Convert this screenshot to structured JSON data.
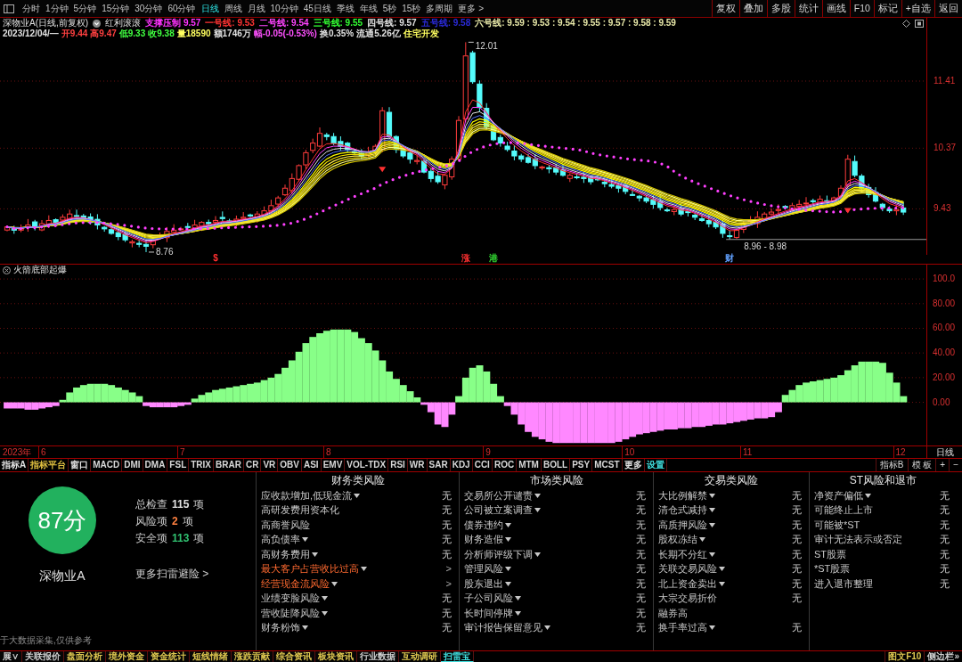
{
  "toolbar": {
    "periods": [
      {
        "label": "分时",
        "selected": false
      },
      {
        "label": "1分钟",
        "selected": false
      },
      {
        "label": "5分钟",
        "selected": false
      },
      {
        "label": "15分钟",
        "selected": false
      },
      {
        "label": "30分钟",
        "selected": false
      },
      {
        "label": "60分钟",
        "selected": false
      },
      {
        "label": "日线",
        "selected": true
      },
      {
        "label": "周线",
        "selected": false
      },
      {
        "label": "月线",
        "selected": false
      },
      {
        "label": "10分钟",
        "selected": false
      },
      {
        "label": "45日线",
        "selected": false
      },
      {
        "label": "季线",
        "selected": false
      },
      {
        "label": "年线",
        "selected": false
      },
      {
        "label": "5秒",
        "selected": false
      },
      {
        "label": "15秒",
        "selected": false
      },
      {
        "label": "多周期",
        "selected": false
      },
      {
        "label": "更多 >",
        "selected": false
      }
    ],
    "actions": [
      "复权",
      "叠加",
      "多股",
      "统计",
      "画线",
      "F10",
      "标记",
      "+自选",
      "返回"
    ]
  },
  "quote": {
    "title": "深物业A(日线,前复权)",
    "indicator": "红利滚滚",
    "values": [
      {
        "text": "支撑压制 9.57",
        "color": "#ff33ff"
      },
      {
        "text": "一号线: 9.53",
        "color": "#ff3333"
      },
      {
        "text": "二号线: 9.54",
        "color": "#ff44ff"
      },
      {
        "text": "三号线: 9.55",
        "color": "#33ff33"
      },
      {
        "text": "四号线: 9.57",
        "color": "#e0e0e0"
      },
      {
        "text": "五号线: 9.58",
        "color": "#2a2ad8"
      },
      {
        "text": "六号线: 9.59 : 9.53 : 9.54 : 9.55 : 9.57 : 9.58 : 9.59",
        "color": "#e8e8a8"
      }
    ],
    "daily": [
      {
        "text": "2023/12/04/—",
        "color": "#e0e0e0"
      },
      {
        "text": "开9.44",
        "color": "#ff4040"
      },
      {
        "text": "高9.47",
        "color": "#ff4040"
      },
      {
        "text": "低9.33",
        "color": "#40ff40"
      },
      {
        "text": "收9.38",
        "color": "#40ff40"
      },
      {
        "text": "量18590",
        "color": "#ffff60"
      },
      {
        "text": "额1746万",
        "color": "#e0e0e0"
      },
      {
        "text": "幅-0.05(-0.53%)",
        "color": "#ff50ff"
      },
      {
        "text": "换0.35%",
        "color": "#e0e0e0"
      },
      {
        "text": "流通5.26亿",
        "color": "#e0e0e0"
      },
      {
        "text": "住宅开发",
        "color": "#ffff60"
      }
    ]
  },
  "price_chart": {
    "axis_labels": [
      "11.41",
      "10.37",
      "9.43"
    ],
    "annotations": [
      "12.01",
      "8.76",
      "8.96 - 8.98"
    ],
    "events": [
      {
        "label": "$",
        "color": "#ff3030"
      },
      {
        "label": "涨",
        "color": "#ff3030"
      },
      {
        "label": "港",
        "color": "#30d030"
      },
      {
        "label": "财",
        "color": "#60a0ff"
      }
    ]
  },
  "indicator_panel": {
    "chart_data": {
      "type": "bar",
      "title": "火箭底部起爆",
      "xlabel": "2023年",
      "categories": [
        null,
        null,
        null,
        null,
        null,
        "6",
        null,
        null,
        null,
        null,
        null,
        null,
        null,
        null,
        null,
        null,
        null,
        null,
        null,
        null,
        null,
        null,
        null,
        null,
        null,
        "7",
        null,
        null,
        null,
        null,
        null,
        null,
        null,
        null,
        null,
        null,
        null,
        null,
        null,
        null,
        null,
        null,
        null,
        null,
        null,
        null,
        "8",
        null,
        null,
        null,
        null,
        null,
        null,
        null,
        null,
        null,
        null,
        null,
        null,
        null,
        null,
        null,
        null,
        null,
        null,
        null,
        null,
        null,
        null,
        "9",
        null,
        null,
        null,
        null,
        null,
        null,
        null,
        null,
        null,
        null,
        null,
        null,
        null,
        null,
        null,
        null,
        null,
        null,
        null,
        "10",
        null,
        null,
        null,
        null,
        null,
        null,
        null,
        null,
        null,
        null,
        null,
        null,
        null,
        null,
        null,
        null,
        "11",
        null,
        null,
        null,
        null,
        null,
        null,
        null,
        null,
        null,
        null,
        null,
        null,
        null,
        null,
        null,
        null,
        null,
        null,
        null,
        null,
        null,
        "12",
        null
      ],
      "ylim": [
        -35,
        112
      ],
      "yticks": [
        {
          "value": 100,
          "label": "100.0"
        },
        {
          "value": 80,
          "label": "80.00"
        },
        {
          "value": 60,
          "label": "60.00"
        },
        {
          "value": 40,
          "label": "40.00"
        },
        {
          "value": 20,
          "label": "20.00"
        },
        {
          "value": 0,
          "label": "0.00"
        }
      ],
      "grid": true,
      "values": [
        -5,
        -5,
        -5,
        -6,
        -6,
        -5,
        -4,
        -3,
        2,
        8,
        12,
        14,
        15,
        15,
        15,
        14,
        12,
        10,
        8,
        5,
        -3,
        -4,
        -4,
        -4,
        -4,
        -3,
        -2,
        3,
        6,
        8,
        10,
        11,
        12,
        13,
        14,
        15,
        16,
        18,
        20,
        23,
        28,
        34,
        41,
        48,
        53,
        56,
        58,
        59,
        59,
        59,
        57,
        52,
        48,
        42,
        34,
        25,
        19,
        14,
        9,
        4,
        -2,
        -8,
        -18,
        -20,
        -10,
        5,
        20,
        28,
        30,
        25,
        15,
        5,
        -3,
        -10,
        -18,
        -24,
        -28,
        -30,
        -32,
        -33,
        -33,
        -33,
        -33,
        -33,
        -33,
        -33,
        -33,
        -33,
        -32,
        -30,
        -28,
        -26,
        -25,
        -24,
        -23,
        -22,
        -22,
        -21,
        -21,
        -20,
        -20,
        -19,
        -18,
        -18,
        -17,
        -16,
        -15,
        -14,
        -13,
        -13,
        -12,
        -8,
        6,
        10,
        14,
        16,
        17,
        18,
        19,
        20,
        22,
        26,
        30,
        33,
        33,
        33,
        32,
        24,
        16,
        5
      ]
    }
  },
  "period_label": "日线",
  "indicator_bar": {
    "tabs": [
      {
        "label": "指标A",
        "color": "#e0e0e0"
      },
      {
        "label": "指标平台",
        "color": "#e0c040"
      },
      {
        "label": "窗口",
        "color": "#e0e0e0"
      },
      {
        "label": "MACD",
        "color": "#d8d8d8"
      },
      {
        "label": "DMI",
        "color": "#d8d8d8"
      },
      {
        "label": "DMA",
        "color": "#d8d8d8"
      },
      {
        "label": "FSL",
        "color": "#d8d8d8"
      },
      {
        "label": "TRIX",
        "color": "#d8d8d8"
      },
      {
        "label": "BRAR",
        "color": "#d8d8d8"
      },
      {
        "label": "CR",
        "color": "#d8d8d8"
      },
      {
        "label": "VR",
        "color": "#d8d8d8"
      },
      {
        "label": "OBV",
        "color": "#d8d8d8"
      },
      {
        "label": "ASI",
        "color": "#d8d8d8"
      },
      {
        "label": "EMV",
        "color": "#d8d8d8"
      },
      {
        "label": "VOL-TDX",
        "color": "#d8d8d8"
      },
      {
        "label": "RSI",
        "color": "#d8d8d8"
      },
      {
        "label": "WR",
        "color": "#d8d8d8"
      },
      {
        "label": "SAR",
        "color": "#d8d8d8"
      },
      {
        "label": "KDJ",
        "color": "#d8d8d8"
      },
      {
        "label": "CCI",
        "color": "#d8d8d8"
      },
      {
        "label": "ROC",
        "color": "#d8d8d8"
      },
      {
        "label": "MTM",
        "color": "#d8d8d8"
      },
      {
        "label": "BOLL",
        "color": "#d8d8d8"
      },
      {
        "label": "PSY",
        "color": "#d8d8d8"
      },
      {
        "label": "MCST",
        "color": "#d8d8d8"
      },
      {
        "label": "更多",
        "color": "#e0e0e0"
      },
      {
        "label": "设置",
        "color": "#40e0e0"
      }
    ],
    "right": [
      "指标B",
      "模 板",
      "+",
      "−"
    ]
  },
  "scan": {
    "score": "87分",
    "stock": "深物业A",
    "stats": [
      {
        "label": "总检查",
        "value": "115",
        "unit": "项",
        "color": "#e0e0e0"
      },
      {
        "label": "风险项",
        "value": "2",
        "unit": "项",
        "color": "#ff8040"
      },
      {
        "label": "安全项",
        "value": "113",
        "unit": "项",
        "color": "#30c070"
      }
    ],
    "more_link": "更多扫雷避险 >",
    "disclaimer": "于大数据采集,仅供参考",
    "categories": [
      {
        "title": "财务类风险",
        "items": [
          {
            "name": "应收款增加,低现金流",
            "expandable": true,
            "status": "无",
            "risk": false
          },
          {
            "name": "高研发费用资本化",
            "expandable": false,
            "status": "无",
            "risk": false
          },
          {
            "name": "高商誉风险",
            "expandable": false,
            "status": "无",
            "risk": false
          },
          {
            "name": "高负债率",
            "expandable": true,
            "status": "无",
            "risk": false
          },
          {
            "name": "高财务费用",
            "expandable": true,
            "status": "无",
            "risk": false
          },
          {
            "name": "最大客户占营收比过高",
            "expandable": true,
            "status": ">",
            "risk": true
          },
          {
            "name": "经营现金流风险",
            "expandable": true,
            "status": ">",
            "risk": true
          },
          {
            "name": "业绩变脸风险",
            "expandable": true,
            "status": "无",
            "risk": false
          },
          {
            "name": "营收陡降风险",
            "expandable": true,
            "status": "无",
            "risk": false
          },
          {
            "name": "财务粉饰",
            "expandable": true,
            "status": "无",
            "risk": false
          }
        ]
      },
      {
        "title": "市场类风险",
        "items": [
          {
            "name": "交易所公开谴责",
            "expandable": true,
            "status": "无",
            "risk": false
          },
          {
            "name": "公司被立案调查",
            "expandable": true,
            "status": "无",
            "risk": false
          },
          {
            "name": "债券违约",
            "expandable": true,
            "status": "无",
            "risk": false
          },
          {
            "name": "财务造假",
            "expandable": true,
            "status": "无",
            "risk": false
          },
          {
            "name": "分析师评级下调",
            "expandable": true,
            "status": "无",
            "risk": false
          },
          {
            "name": "管理风险",
            "expandable": true,
            "status": "无",
            "risk": false
          },
          {
            "name": "股东退出",
            "expandable": true,
            "status": "无",
            "risk": false
          },
          {
            "name": "子公司风险",
            "expandable": true,
            "status": "无",
            "risk": false
          },
          {
            "name": "长时间停牌",
            "expandable": true,
            "status": "无",
            "risk": false
          },
          {
            "name": "审计报告保留意见",
            "expandable": true,
            "status": "无",
            "risk": false
          }
        ]
      },
      {
        "title": "交易类风险",
        "items": [
          {
            "name": "大比例解禁",
            "expandable": true,
            "status": "无",
            "risk": false
          },
          {
            "name": "清仓式减持",
            "expandable": true,
            "status": "无",
            "risk": false
          },
          {
            "name": "高质押风险",
            "expandable": true,
            "status": "无",
            "risk": false
          },
          {
            "name": "股权冻结",
            "expandable": true,
            "status": "无",
            "risk": false
          },
          {
            "name": "长期不分红",
            "expandable": true,
            "status": "无",
            "risk": false
          },
          {
            "name": "关联交易风险",
            "expandable": true,
            "status": "无",
            "risk": false
          },
          {
            "name": "北上资金卖出",
            "expandable": true,
            "status": "无",
            "risk": false
          },
          {
            "name": "大宗交易折价",
            "expandable": false,
            "status": "无",
            "risk": false
          },
          {
            "name": "融券高",
            "expandable": false,
            "risk": false
          },
          {
            "name": "换手率过高",
            "expandable": true,
            "status": "无",
            "risk": false
          }
        ]
      },
      {
        "title": "ST风险和退市",
        "items": [
          {
            "name": "净资产偏低",
            "expandable": true,
            "status": "无",
            "risk": false
          },
          {
            "name": "可能终止上市",
            "expandable": false,
            "status": "无",
            "risk": false
          },
          {
            "name": "可能被*ST",
            "expandable": false,
            "status": "无",
            "risk": false
          },
          {
            "name": "审计无法表示或否定",
            "expandable": false,
            "status": "无",
            "risk": false
          },
          {
            "name": "ST股票",
            "expandable": false,
            "status": "无",
            "risk": false
          },
          {
            "name": "*ST股票",
            "expandable": false,
            "status": "无",
            "risk": false
          },
          {
            "name": "进入退市整理",
            "expandable": false,
            "status": "无",
            "risk": false
          }
        ]
      }
    ]
  },
  "bottom_tabs": {
    "tabs": [
      {
        "label": "展∨",
        "color": "#d0d0d0",
        "selected": false
      },
      {
        "label": "关联报价",
        "color": "#d0d0d0",
        "selected": false
      },
      {
        "label": "盘面分析",
        "color": "#e0c850",
        "selected": false
      },
      {
        "label": "境外资金",
        "color": "#e0c850",
        "selected": false
      },
      {
        "label": "资金统计",
        "color": "#e0c850",
        "selected": false
      },
      {
        "label": "短线情绪",
        "color": "#e0c850",
        "selected": false
      },
      {
        "label": "涨跌贡献",
        "color": "#e0c850",
        "selected": false
      },
      {
        "label": "综合资讯",
        "color": "#e0c850",
        "selected": false
      },
      {
        "label": "板块资讯",
        "color": "#e0c850",
        "selected": false
      },
      {
        "label": "行业数据",
        "color": "#d0d0d0",
        "selected": false
      },
      {
        "label": "互动调研",
        "color": "#e0c850",
        "selected": false
      },
      {
        "label": "扫雷宝",
        "color": "#40e0e0",
        "selected": true
      }
    ],
    "right": [
      {
        "label": "图文F10",
        "color": "#e0c850"
      },
      {
        "label": "侧边栏»",
        "color": "#d0d0d0"
      }
    ]
  }
}
